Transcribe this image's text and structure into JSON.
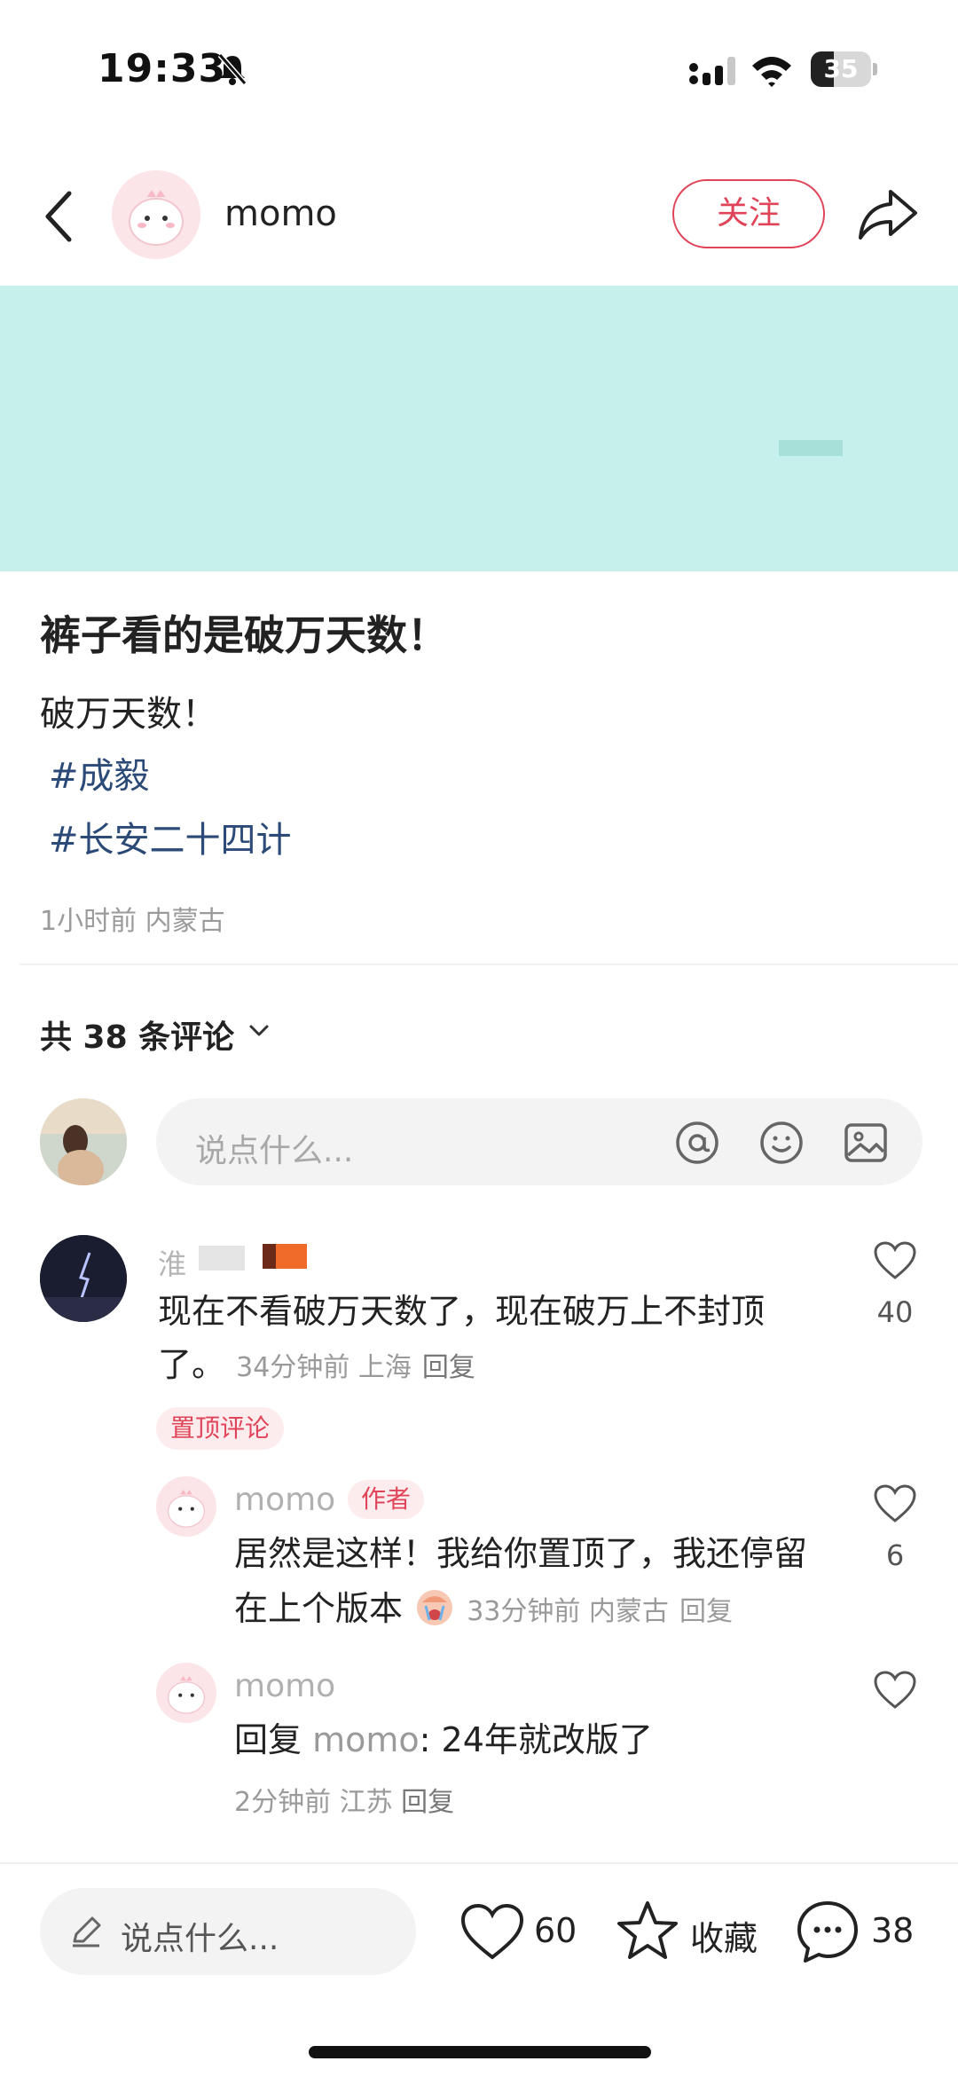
{
  "status_bar": {
    "time": "19:33",
    "battery": "35"
  },
  "header": {
    "username": "momo",
    "follow_label": "关注"
  },
  "post": {
    "title": "裤子看的是破万天数！",
    "body": "破万天数！",
    "tags": [
      "#成毅",
      "#长安二十四计"
    ],
    "meta": "1小时前 内蒙古"
  },
  "comments_header": {
    "count_label": "共 38 条评论"
  },
  "comment_input": {
    "placeholder": "说点什么..."
  },
  "comments": [
    {
      "name": "淮",
      "text": "现在不看破万天数了，现在破万上不封顶了。",
      "meta": "34分钟前 上海",
      "reply_label": "回复",
      "pin_label": "置顶评论",
      "likes": "40"
    }
  ],
  "replies": [
    {
      "name": "momo",
      "badge": "作者",
      "text_line1": "居然是这样！我给你置顶了，我还停留",
      "text_line2": "在上个版本",
      "meta": "33分钟前 内蒙古",
      "reply_label": "回复",
      "likes": "6"
    },
    {
      "name": "momo",
      "prefix": "回复",
      "target": "momo",
      "text": ": 24年就改版了",
      "meta": "2分钟前 江苏",
      "reply_label": "回复"
    }
  ],
  "bottom_bar": {
    "placeholder": "说点什么...",
    "likes": "60",
    "collect_label": "收藏",
    "comments": "38"
  },
  "colors": {
    "accent": "#e04458",
    "hashtag": "#2b4a78",
    "hero_bg": "#c6f0ec"
  }
}
